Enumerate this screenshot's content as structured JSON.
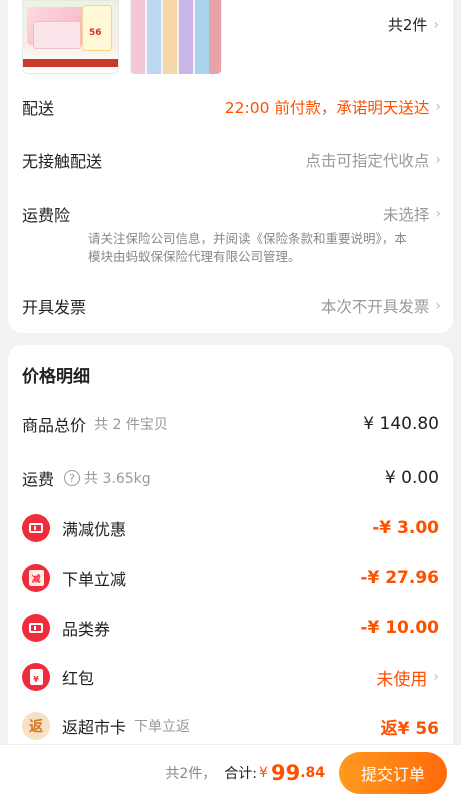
{
  "order": {
    "item_count_label": "共2件",
    "thumb_a": {
      "price_tag": "56"
    }
  },
  "delivery": {
    "label": "配送",
    "value": "22:00 前付款，承诺明天送达"
  },
  "contactless": {
    "label": "无接触配送",
    "value": "点击可指定代收点"
  },
  "shipping_insurance": {
    "label": "运费险",
    "value": "未选择",
    "note": "请关注保险公司信息，并阅读《保险条款和重要说明》，本模块由蚂蚁保保险代理有限公司管理。"
  },
  "invoice": {
    "label": "开具发票",
    "value": "本次不开具发票"
  },
  "price_detail": {
    "title": "价格明细",
    "goods_total": {
      "label": "商品总价",
      "sub": "共 2 件宝贝",
      "amount": "¥ 140.80"
    },
    "shipping": {
      "label": "运费",
      "help": "?",
      "sub": "共 3.65kg",
      "amount": "¥ 0.00"
    },
    "promos": [
      {
        "label": "满减优惠",
        "amount": "-¥ 3.00",
        "icon": "ticket-icon"
      },
      {
        "label": "下单立减",
        "amount": "-¥ 27.96",
        "icon": "instant-discount-icon",
        "icon_text": "减"
      },
      {
        "label": "品类券",
        "amount": "-¥ 10.00",
        "icon": "ticket-icon"
      },
      {
        "label": "红包",
        "amount": "未使用",
        "icon": "red-packet-icon",
        "icon_text": "¥"
      },
      {
        "label": "返超市卡",
        "sub": "下单立返",
        "amount": "返¥ 56",
        "icon": "cashback-icon",
        "icon_text": "返"
      }
    ]
  },
  "footer": {
    "count": "共2件，",
    "total_label": "合计:",
    "currency": "¥",
    "total_int": "99",
    "total_dec": ".84",
    "submit_label": "提交订单"
  },
  "colors": {
    "accent": "#ff5000",
    "promo_red": "#f02b3a",
    "button_gradient_start": "#ff9a1e",
    "button_gradient_end": "#ff6a0a"
  }
}
